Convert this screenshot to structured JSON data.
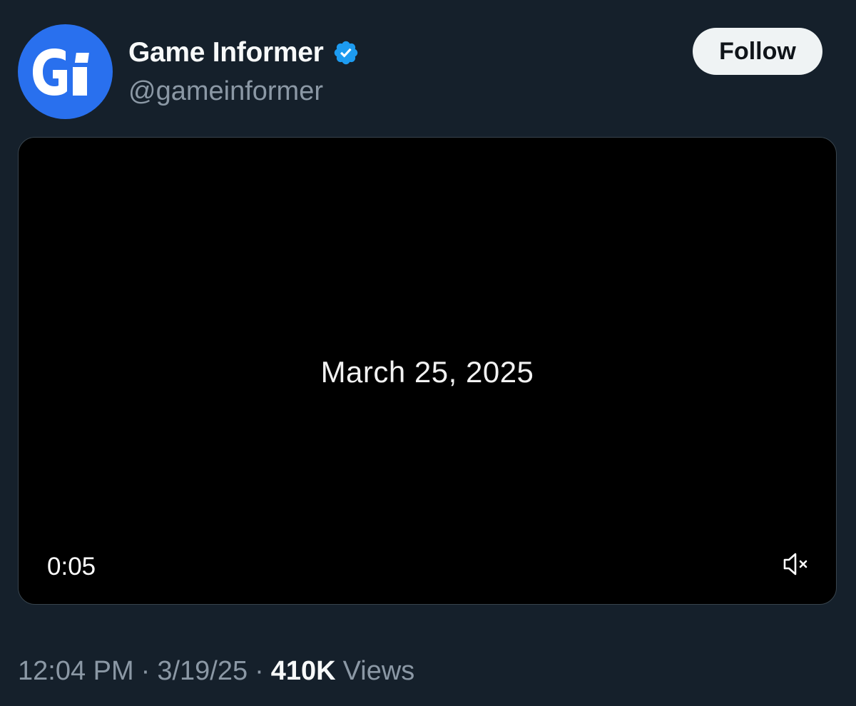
{
  "account": {
    "display_name": "Game Informer",
    "handle": "@gameinformer",
    "avatar_text": "GI",
    "avatar_color": "#2970ee",
    "verified_icon": "verified-badge-icon",
    "verified_color": "#1d9bf0"
  },
  "follow_button": {
    "label": "Follow"
  },
  "video": {
    "overlay_text": "March 25, 2025",
    "time": "0:05",
    "mute_icon": "muted-speaker-icon"
  },
  "meta": {
    "time": "12:04 PM",
    "separator": "·",
    "date": "3/19/25",
    "views_count": "410K",
    "views_label": "Views"
  }
}
